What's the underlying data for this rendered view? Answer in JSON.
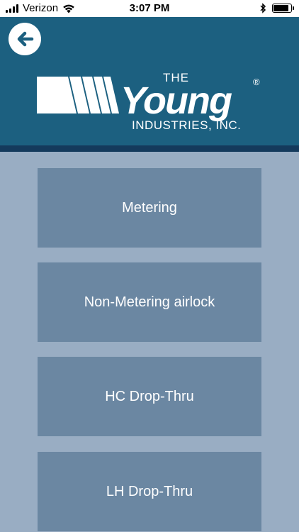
{
  "status_bar": {
    "carrier": "Verizon",
    "time": "3:07 PM",
    "icons": [
      "signal-bars-icon",
      "wifi-icon",
      "bluetooth-icon",
      "battery-icon"
    ]
  },
  "header": {
    "back_icon": "arrow-left-icon",
    "logo": {
      "the": "THE",
      "brand": "Young",
      "registered": "®",
      "company": "INDUSTRIES, INC."
    }
  },
  "menu": {
    "items": [
      {
        "label": "Metering"
      },
      {
        "label": "Non-Metering airlock"
      },
      {
        "label": "HC Drop-Thru"
      },
      {
        "label": "LH Drop-Thru"
      }
    ]
  },
  "colors": {
    "header": "#1c6080",
    "header_stripe": "#143a5c",
    "background": "#99adc3",
    "menu_item": "#6b87a2",
    "text": "#ffffff"
  }
}
